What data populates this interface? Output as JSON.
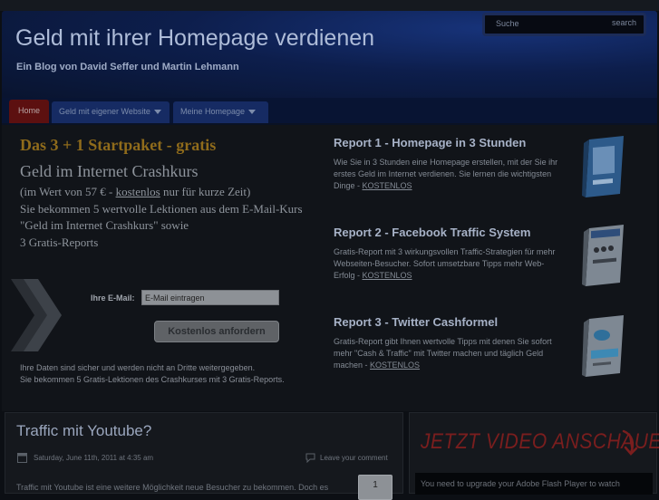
{
  "header": {
    "title": "Geld mit ihrer Homepage verdienen",
    "tagline": "Ein Blog von David Seffer und Martin Lehmann",
    "search_placeholder": "Suche",
    "search_button": "search"
  },
  "nav": {
    "items": [
      {
        "label": "Home",
        "active": true
      },
      {
        "label": "Geld mit eigener Website",
        "has_dropdown": true
      },
      {
        "label": "Meine Homepage",
        "has_dropdown": true
      }
    ]
  },
  "promo": {
    "title": "Das 3 + 1 Startpaket - gratis",
    "subtitle": "Geld im Internet Crashkurs",
    "line1_pre": "(im Wert von 57 € - ",
    "line1_link": "kostenlos",
    "line1_post": " nur für kurze Zeit)",
    "line2": "Sie bekommen 5 wertvolle Lektionen aus dem E-Mail-Kurs \"Geld im Internet Crashkurs\" sowie",
    "line3": "3 Gratis-Reports",
    "email_label": "Ihre E-Mail:",
    "email_placeholder": "E-Mail eintragen",
    "submit_label": "Kostenlos anfordern",
    "privacy_line1": "Ihre Daten sind sicher und werden nicht an Dritte weitergegeben.",
    "privacy_line2": "Sie bekommen 5 Gratis-Lektionen des Crashkurses mit 3 Gratis-Reports."
  },
  "reports": [
    {
      "title": "Report 1 - Homepage in 3 Stunden",
      "text": "Wie Sie in 3 Stunden eine Homepage erstellen, mit der Sie ihr erstes Geld im Internet verdienen. Sie lernen die wichtigsten Dinge - ",
      "link": "KOSTENLOS"
    },
    {
      "title": "Report 2 - Facebook Traffic System",
      "text": "Gratis-Report mit 3 wirkungsvollen Traffic-Strategien für mehr Webseiten-Besucher. Sofort umsetzbare Tipps mehr Web-Erfolg - ",
      "link": "KOSTENLOS"
    },
    {
      "title": "Report 3 - Twitter Cashformel",
      "text": "Gratis-Report gibt Ihnen wertvolle Tipps mit denen Sie sofort mehr \"Cash & Traffic\" mit Twitter machen und täglich Geld machen - ",
      "link": "KOSTENLOS"
    }
  ],
  "post": {
    "title": "Traffic mit Youtube?",
    "date": "Saturday, June 11th, 2011 at 4:35 am",
    "comment_link": "Leave your comment",
    "excerpt": "Traffic mit Youtube ist eine weitere Möglichkeit neue Besucher zu bekommen. Doch es",
    "counter": "1"
  },
  "sidebar": {
    "video_heading": "JETZT VIDEO ANSCHAUEN",
    "flash_notice": "You need to upgrade your Adobe Flash Player to watch"
  },
  "colors": {
    "header_blue": "#0d1e4c",
    "nav_active": "#5c1010",
    "promo_title": "#8f6b1b",
    "video_heading": "#7a1e1e"
  }
}
